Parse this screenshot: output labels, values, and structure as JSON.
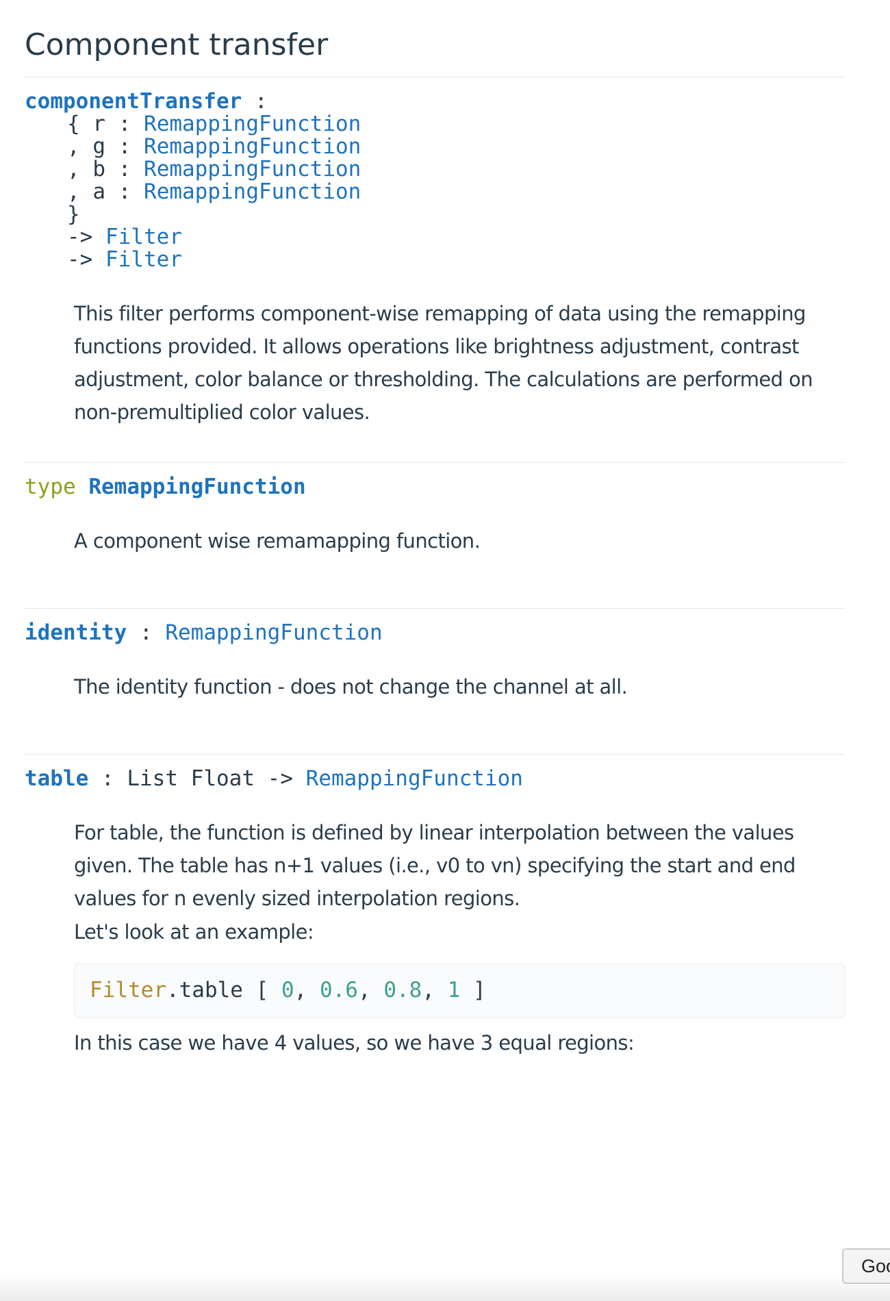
{
  "page_title": "Component transfer",
  "component_transfer": {
    "name": "componentTransfer",
    "colon": ":",
    "fields": [
      {
        "prefix": "{",
        "field": "r",
        "type": "RemappingFunction"
      },
      {
        "prefix": ",",
        "field": "g",
        "type": "RemappingFunction"
      },
      {
        "prefix": ",",
        "field": "b",
        "type": "RemappingFunction"
      },
      {
        "prefix": ",",
        "field": "a",
        "type": "RemappingFunction"
      }
    ],
    "close_brace": "}",
    "arrow": "->",
    "returns": [
      "Filter",
      "Filter"
    ],
    "description": "This filter performs component-wise remapping of data using the remapping functions provided. It allows operations like brightness adjustment, contrast adjustment, color balance or thresholding. The calculations are performed on non-premultiplied color values."
  },
  "remapping_type": {
    "keyword": "type",
    "name": "RemappingFunction",
    "description": "A component wise remamapping function."
  },
  "identity": {
    "name": "identity",
    "colon": ":",
    "type": "RemappingFunction",
    "description": "The identity function - does not change the channel at all."
  },
  "table": {
    "name": "table",
    "colon": ":",
    "arg_types": "List Float",
    "arrow": "->",
    "return_type": "RemappingFunction",
    "description": "For table, the function is defined by linear interpolation between the values given. The table has n+1 values (i.e., v0 to vn) specifying the start and end values for n evenly sized interpolation regions.",
    "example_intro": "Let's look at an example:",
    "example_code": {
      "module": "Filter",
      "dot_func": ".table",
      "open": "[",
      "values": [
        "0",
        "0.6",
        "0.8",
        "1"
      ],
      "close": "]"
    },
    "after_example": "In this case we have 4 values, so we have 3 equal regions:"
  },
  "google_button_label": "Goo"
}
